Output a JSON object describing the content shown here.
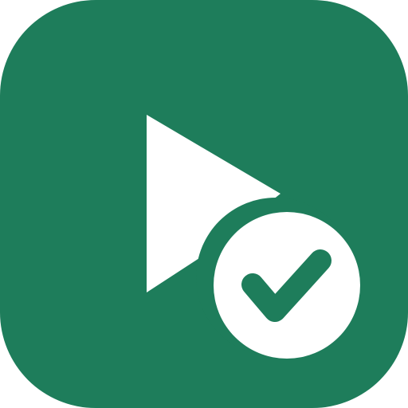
{
  "icon": {
    "name": "play-check-app-icon",
    "background_color": "#1e7d5b",
    "foreground_color": "#ffffff",
    "glyphs": [
      "play-icon",
      "check-circle-icon"
    ]
  }
}
